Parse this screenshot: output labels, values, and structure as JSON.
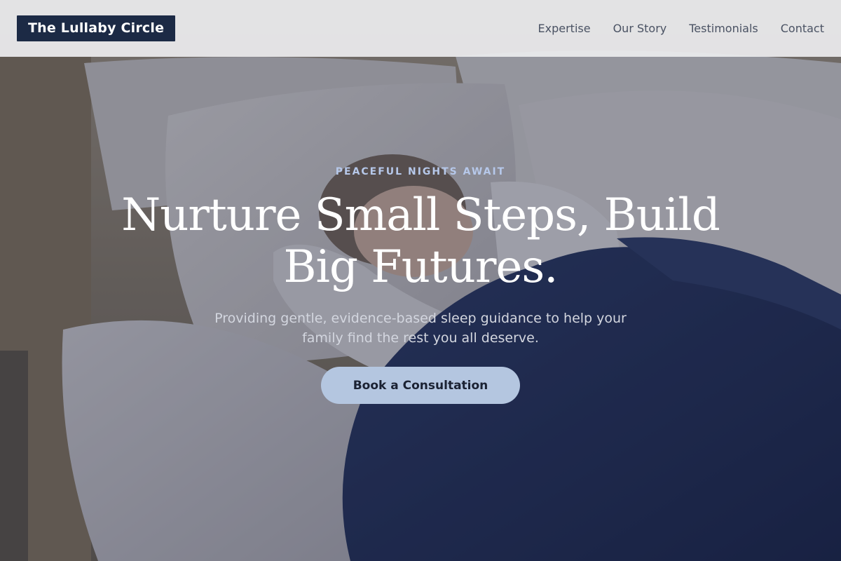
{
  "header": {
    "brand": "The Lullaby Circle",
    "nav": [
      {
        "label": "Expertise"
      },
      {
        "label": "Our Story"
      },
      {
        "label": "Testimonials"
      },
      {
        "label": "Contact"
      }
    ]
  },
  "hero": {
    "eyebrow": "PEACEFUL NIGHTS AWAIT",
    "headline": "Nurture Small Steps, Build Big Futures.",
    "subtitle": "Providing gentle, evidence-based sleep guidance to help your family find the rest you all deserve.",
    "cta_label": "Book a Consultation",
    "background_image": "photo of a woman sleeping in bed with white pillows and a navy duvet"
  },
  "colors": {
    "brand_bg": "#1c2a45",
    "nav_text": "#4a5263",
    "eyebrow": "#b6c8ea",
    "cta_bg": "#b4c6e0",
    "cta_text": "#1b2233",
    "duvet": "#1f2d55"
  }
}
